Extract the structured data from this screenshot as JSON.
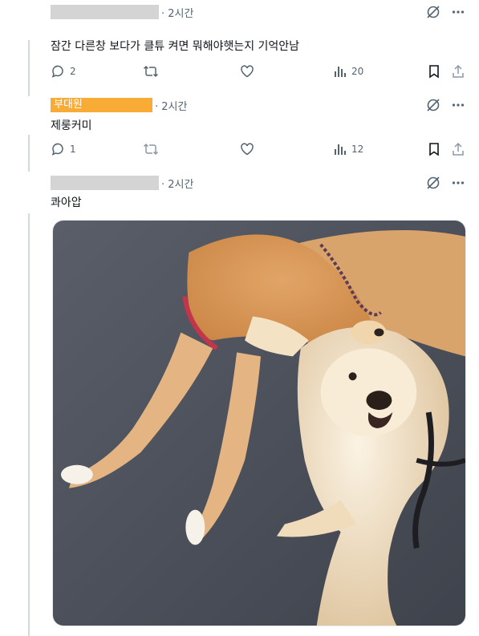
{
  "tweets": [
    {
      "author_redacted": true,
      "time": "· 2시간",
      "text": "잠간 다른창 보다가 클튜 켜면 뭐해야햇는지 기억안남",
      "replies": "2",
      "retweets": "",
      "likes": "",
      "views": "20"
    },
    {
      "author": "부대원",
      "time": "· 2시간",
      "text": "제룽커미",
      "replies": "1",
      "retweets": "",
      "likes": "",
      "views": "12"
    },
    {
      "author_redacted": true,
      "time": "· 2시간",
      "text": "콰아압"
    }
  ],
  "colors": {
    "badge": "#f8ab35",
    "muted": "#536471",
    "thread_line": "#cfd9de"
  },
  "icons": [
    "grok-icon",
    "more-icon",
    "reply-icon",
    "retweet-icon",
    "like-icon",
    "views-icon",
    "bookmark-icon",
    "share-icon"
  ]
}
